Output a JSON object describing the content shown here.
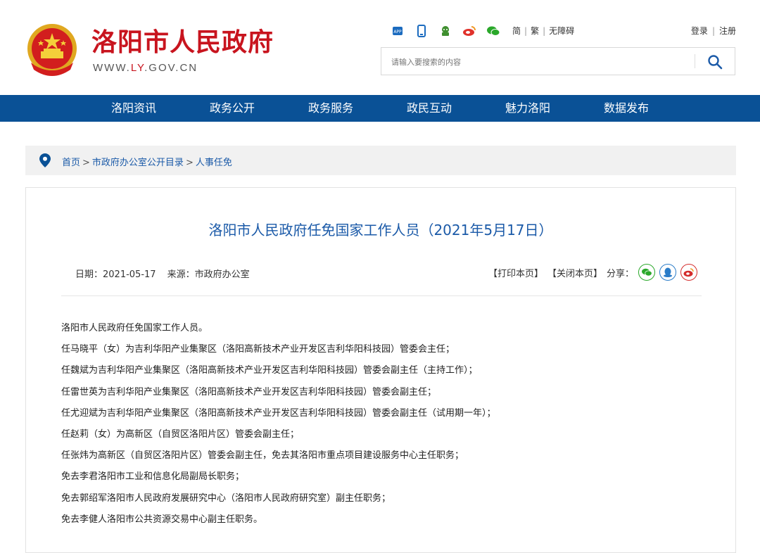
{
  "header": {
    "title": "洛阳市人民政府",
    "url_prefix": "WWW.",
    "url_highlight": "LY",
    "url_suffix": ".GOV.CN",
    "lang_links": [
      "简",
      "繁",
      "无障碍"
    ],
    "auth_links": [
      "登录",
      "注册"
    ],
    "search_placeholder": "请输入要搜索的内容",
    "tool_icons": [
      "app-icon",
      "mobile-icon",
      "robot-icon",
      "weibo-icon",
      "wechat-icon"
    ]
  },
  "nav": {
    "items": [
      "洛阳资讯",
      "政务公开",
      "政务服务",
      "政民互动",
      "魅力洛阳",
      "数据发布"
    ]
  },
  "breadcrumb": {
    "items": [
      "首页",
      "市政府办公室公开目录",
      "人事任免"
    ],
    "separator": ">"
  },
  "article": {
    "title": "洛阳市人民政府任免国家工作人员（2021年5月17日）",
    "date_label": "日期：",
    "date": "2021-05-17",
    "source_label": "来源：",
    "source": "市政府办公室",
    "print_label": "【打印本页】",
    "close_label": "【关闭本页】",
    "share_label": "分享：",
    "paragraphs": [
      "洛阳市人民政府任免国家工作人员。",
      "任马晓平（女）为吉利华阳产业集聚区（洛阳高新技术产业开发区吉利华阳科技园）管委会主任；",
      "任魏斌为吉利华阳产业集聚区（洛阳高新技术产业开发区吉利华阳科技园）管委会副主任（主持工作）；",
      "任雷世英为吉利华阳产业集聚区（洛阳高新技术产业开发区吉利华阳科技园）管委会副主任；",
      "任尤迎斌为吉利华阳产业集聚区（洛阳高新技术产业开发区吉利华阳科技园）管委会副主任（试用期一年）；",
      "任赵莉（女）为高新区（自贸区洛阳片区）管委会副主任；",
      "任张炜为高新区（自贸区洛阳片区）管委会副主任，免去其洛阳市重点项目建设服务中心主任职务；",
      "免去李君洛阳市工业和信息化局副局长职务；",
      "免去郭绍军洛阳市人民政府发展研究中心（洛阳市人民政府研究室）副主任职务；",
      "免去李健人洛阳市公共资源交易中心副主任职务。"
    ]
  },
  "colors": {
    "brand_red": "#c8141e",
    "nav_blue": "#0a5196",
    "link_blue": "#1b5aa8",
    "wechat_green": "#2aa82a",
    "qq_blue": "#2a7cc8",
    "weibo_red": "#d42c2c"
  }
}
